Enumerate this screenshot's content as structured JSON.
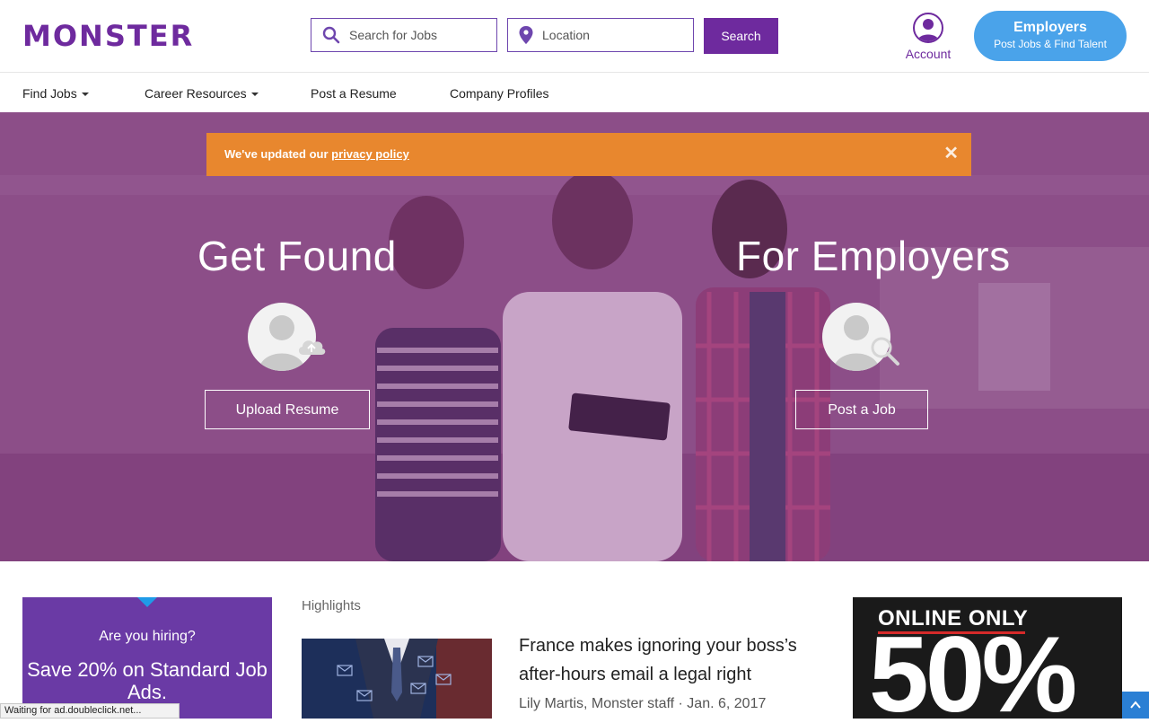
{
  "header": {
    "logo": "MONSTER",
    "search_placeholder": "Search for Jobs",
    "location_placeholder": "Location",
    "search_button": "Search",
    "account_label": "Account",
    "employers_title": "Employers",
    "employers_subtitle": "Post Jobs & Find Talent"
  },
  "nav": {
    "items": [
      {
        "label": "Find Jobs",
        "dropdown": true
      },
      {
        "label": "Career Resources",
        "dropdown": true
      },
      {
        "label": "Post a Resume",
        "dropdown": false
      },
      {
        "label": "Company Profiles",
        "dropdown": false
      }
    ]
  },
  "privacy_banner": {
    "text": "We've updated our ",
    "link": "privacy policy",
    "close": "✕"
  },
  "hero": {
    "left_title": "Get Found",
    "left_button": "Upload Resume",
    "right_title": "For Employers",
    "right_button": "Post a Job"
  },
  "promo": {
    "question": "Are you hiring?",
    "offer": "Save 20% on Standard Job Ads."
  },
  "highlights": {
    "heading": "Highlights",
    "article_title": "France makes ignoring your boss’s after-hours email a legal right",
    "article_meta": "Lily Martis, Monster staff · Jan. 6, 2017"
  },
  "ad": {
    "top_text": "ONLINE ONLY",
    "big_text": "50%"
  },
  "status_bar": {
    "text": "Waiting for ad.doubleclick.net..."
  },
  "colors": {
    "brand_purple": "#6e2a9e",
    "employers_blue": "#4aa3ea",
    "banner_orange": "#e8872e",
    "hero_tint": "#8c5587"
  }
}
